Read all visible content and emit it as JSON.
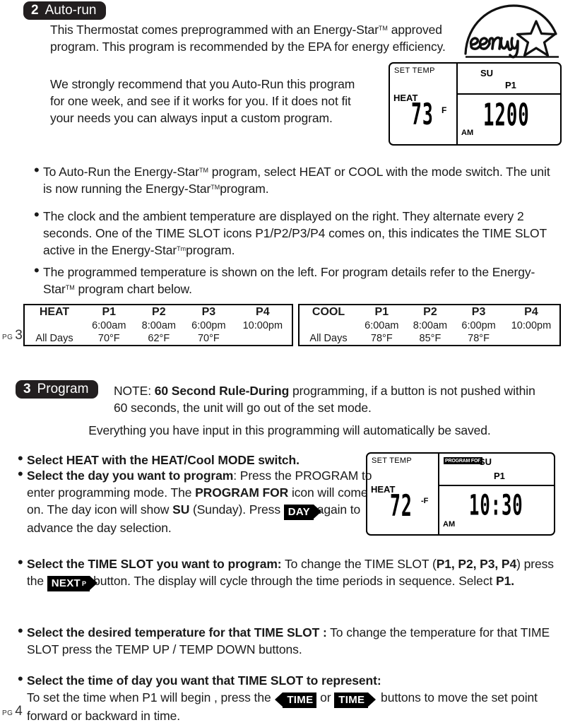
{
  "sections": {
    "auto_run": {
      "badge_number": "2",
      "badge_label": "Auto-run",
      "para1_a": "This Thermostat comes preprogrammed with an Energy-Star",
      "para1_tm": "TM",
      "para1_b": "approved program. This program is recommended by the EPA for energy efficiency.",
      "para2": "We strongly recommend that you Auto-Run this program for one week, and see if it works for you. If it does not fit your needs you can always input a custom program.",
      "bullets": [
        {
          "p1": "To Auto-Run the Energy-Star",
          "tm1": "TM",
          "p2": " program, select HEAT or COOL with the mode switch. The unit is now running the Energy-Star",
          "tm2": "TM",
          "p3": "program."
        },
        {
          "p1": "The clock and the ambient temperature are displayed on the right. They alternate every 2 seconds.  One of the TIME SLOT icons P1/P2/P3/P4 comes on, this indicates the TIME SLOT active in the Energy-Star",
          "tm1": "Tm",
          "p2": "program."
        },
        {
          "p1": "The programmed temperature is shown on the left. For program details refer to the Energy-Star",
          "tm1": "TM",
          "p2": " program chart below."
        }
      ]
    },
    "program": {
      "badge_number": "3",
      "badge_label": "Program",
      "note_prefix": "NOTE: ",
      "note_bold": "60 Second Rule-During",
      "note_rest": " programming, if a button is not pushed within 60 seconds, the unit will go out of the set mode.",
      "note_line3": "Everything you have input in this programming will automatically be saved.",
      "bullets": [
        {
          "bold": "Select HEAT with the HEAT/Cool MODE switch.",
          "rest": ""
        },
        {
          "bold": "Select the day you want to program",
          "rest_a": ": Press the PROGRAM to enter programming mode. The ",
          "icon_bold": "PROGRAM FOR",
          "rest_b": " icon will come on. The day icon will show ",
          "day_bold": "SU",
          "rest_c": " (Sunday). Press ",
          "key": "DAY",
          "rest_d": " again to advance the day selection."
        },
        {
          "bold": "Select the TIME SLOT you want to program:",
          "rest_a": " To change the TIME SLOT (",
          "slots_bold": "P1, P2, P3, P4",
          "rest_b": ") press the ",
          "key": "NEXT",
          "key_sub": "P",
          "rest_c": " button. The display will cycle through the time periods in sequence.  Select ",
          "select_bold": "P1."
        },
        {
          "bold": "Select the desired temperature for that TIME SLOT :",
          "rest_a": " To change the temperature for that TIME SLOT press the TEMP UP / TEMP DOWN buttons."
        },
        {
          "bold": "Select the time of day you want that TIME SLOT to represent:",
          "rest_a": "To set the time when  P1 will begin , press the ",
          "key_left": "TIME",
          "mid": " or ",
          "key_right": "TIME",
          "rest_b": " buttons to move the set point forward or backward in time."
        }
      ]
    }
  },
  "lcd_top": {
    "set_temp_label": "SET TEMP",
    "mode_label": "HEAT",
    "temperature": "73",
    "unit": "F",
    "day": "SU",
    "time_slot": "P1",
    "meridiem": "AM",
    "time": "1200"
  },
  "lcd_bottom": {
    "set_temp_label": "SET TEMP",
    "program_for_label": "PROGRAM FOR",
    "mode_label": "HEAT",
    "temperature": "72",
    "unit": "-F",
    "day": "SU",
    "time_slot": "P1",
    "meridiem": "AM",
    "time": "10:30"
  },
  "chart_data": {
    "type": "table",
    "title": "Energy-Star program chart",
    "tables": [
      {
        "mode": "HEAT",
        "days": "All Days",
        "columns": [
          "P1",
          "P2",
          "P3",
          "P4"
        ],
        "times": [
          "6:00am",
          "8:00am",
          "6:00pm",
          "10:00pm"
        ],
        "temperatures": [
          "70°F",
          "62°F",
          "70°F",
          ""
        ]
      },
      {
        "mode": "COOL",
        "days": "All Days",
        "columns": [
          "P1",
          "P2",
          "P3",
          "P4"
        ],
        "times": [
          "6:00am",
          "8:00am",
          "6:00pm",
          "10:00pm"
        ],
        "temperatures": [
          "78°F",
          "85°F",
          "78°F",
          ""
        ]
      }
    ]
  },
  "page_numbers": {
    "top": {
      "label": "PG",
      "number": "3"
    },
    "bottom": {
      "label": "PG",
      "number": "4"
    }
  },
  "logo": {
    "name": "energy-star-logo",
    "word": "energy"
  }
}
